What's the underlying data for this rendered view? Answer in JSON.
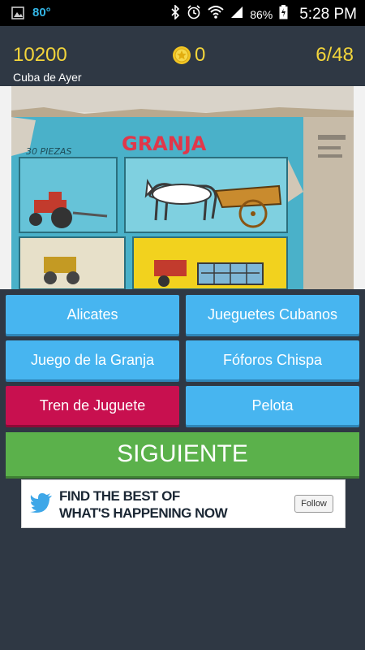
{
  "status_bar": {
    "temperature": "80°",
    "battery": "86%",
    "time": "5:28 PM"
  },
  "header": {
    "score": "10200",
    "coins": "0",
    "progress": "6/48",
    "category": "Cuba de Ayer"
  },
  "photo": {
    "title_text": "GRANJA",
    "pieces_text": "30 PIEZAS"
  },
  "answers": [
    {
      "label": "Alicates",
      "state": "normal"
    },
    {
      "label": "Jueguetes Cubanos",
      "state": "normal"
    },
    {
      "label": "Juego de la Granja",
      "state": "normal"
    },
    {
      "label": "Fóforos Chispa",
      "state": "normal"
    },
    {
      "label": "Tren de Juguete",
      "state": "wrong"
    },
    {
      "label": "Pelota",
      "state": "normal"
    }
  ],
  "next_label": "SIGUIENTE",
  "ad": {
    "line1": "FIND THE BEST OF",
    "line2": "WHAT'S HAPPENING NOW",
    "follow_label": "Follow"
  },
  "colors": {
    "background": "#2f3844",
    "accent_yellow": "#f3d53b",
    "answer_blue": "#47b5f0",
    "answer_wrong": "#c8104f",
    "next_green": "#5bb14b"
  }
}
